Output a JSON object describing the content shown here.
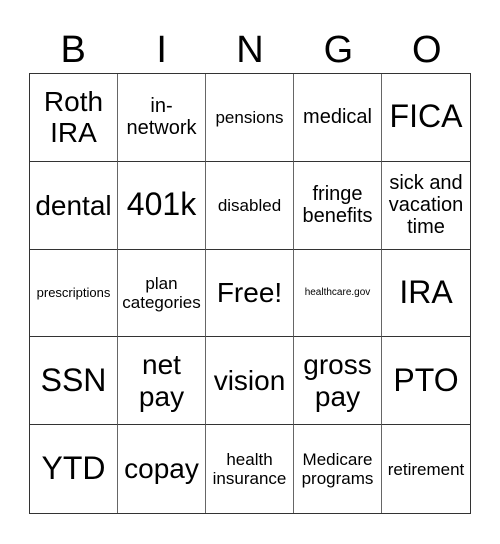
{
  "header": {
    "letters": [
      "B",
      "I",
      "N",
      "G",
      "O"
    ]
  },
  "cells": [
    {
      "text": "Roth IRA",
      "size": "s-l"
    },
    {
      "text": "in-network",
      "size": "s-m"
    },
    {
      "text": "pensions",
      "size": "s-s"
    },
    {
      "text": "medical",
      "size": "s-m"
    },
    {
      "text": "FICA",
      "size": "s-xl"
    },
    {
      "text": "dental",
      "size": "s-l"
    },
    {
      "text": "401k",
      "size": "s-xl"
    },
    {
      "text": "disabled",
      "size": "s-s"
    },
    {
      "text": "fringe benefits",
      "size": "s-m"
    },
    {
      "text": "sick and vacation time",
      "size": "s-m"
    },
    {
      "text": "prescriptions",
      "size": "s-xs"
    },
    {
      "text": "plan categories",
      "size": "s-s"
    },
    {
      "text": "Free!",
      "size": "s-l"
    },
    {
      "text": "healthcare.gov",
      "size": "s-xxs"
    },
    {
      "text": "IRA",
      "size": "s-xl"
    },
    {
      "text": "SSN",
      "size": "s-xl"
    },
    {
      "text": "net pay",
      "size": "s-l"
    },
    {
      "text": "vision",
      "size": "s-l"
    },
    {
      "text": "gross pay",
      "size": "s-l"
    },
    {
      "text": "PTO",
      "size": "s-xl"
    },
    {
      "text": "YTD",
      "size": "s-xl"
    },
    {
      "text": "copay",
      "size": "s-l"
    },
    {
      "text": "health insurance",
      "size": "s-s"
    },
    {
      "text": "Medicare programs",
      "size": "s-s"
    },
    {
      "text": "retirement",
      "size": "s-s"
    }
  ]
}
